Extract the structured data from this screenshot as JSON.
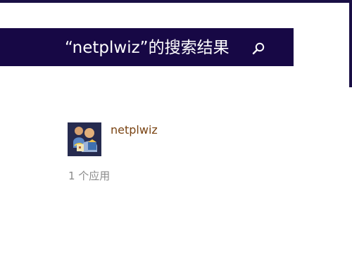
{
  "header": {
    "title": "“netplwiz”的搜索结果"
  },
  "results": {
    "items": [
      {
        "name": "netplwiz",
        "icon": "user-accounts-icon"
      }
    ],
    "count_label": "1 个应用"
  },
  "colors": {
    "header_background": "#170845",
    "page_background": "#ffffff",
    "result_name": "#7a4413",
    "result_count": "#8a8a8a"
  }
}
